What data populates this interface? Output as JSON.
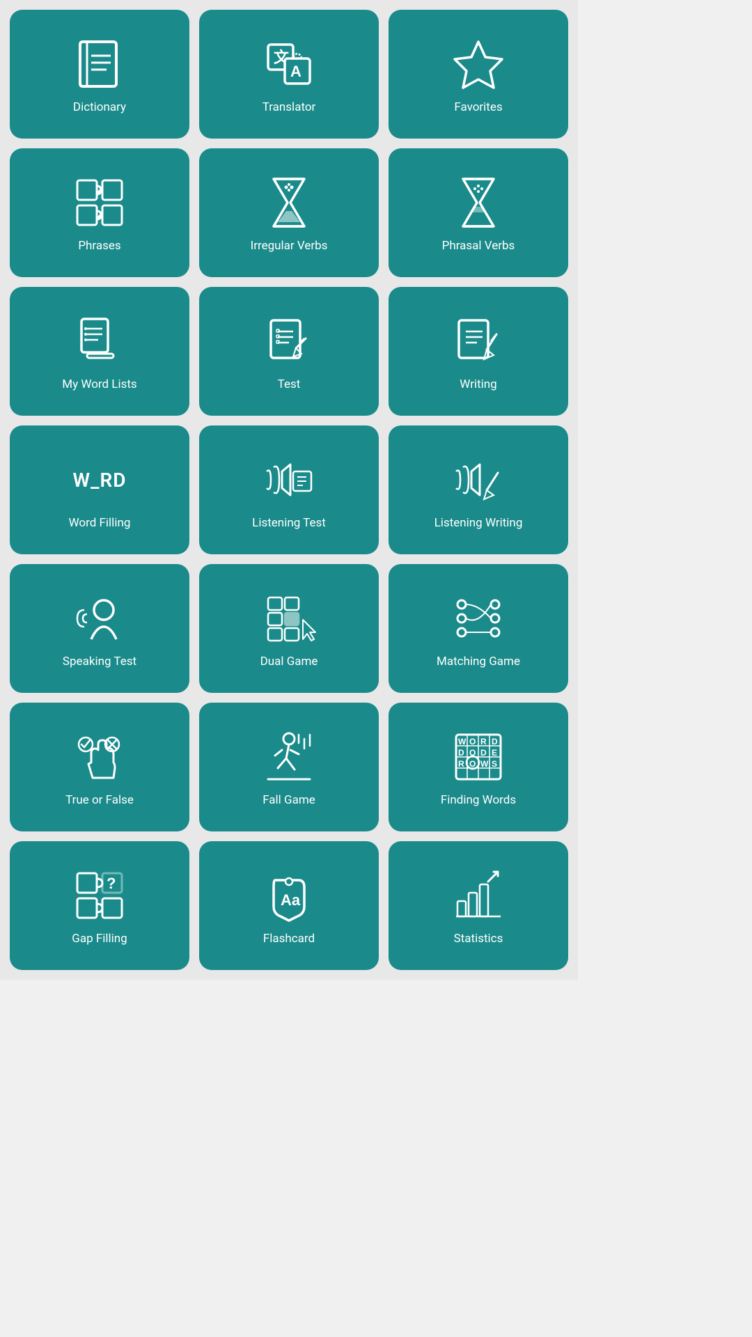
{
  "tiles": [
    {
      "id": "dictionary",
      "label": "Dictionary",
      "icon": "dictionary"
    },
    {
      "id": "translator",
      "label": "Translator",
      "icon": "translator"
    },
    {
      "id": "favorites",
      "label": "Favorites",
      "icon": "favorites"
    },
    {
      "id": "phrases",
      "label": "Phrases",
      "icon": "phrases"
    },
    {
      "id": "irregular-verbs",
      "label": "Irregular Verbs",
      "icon": "hourglass"
    },
    {
      "id": "phrasal-verbs",
      "label": "Phrasal Verbs",
      "icon": "hourglass2"
    },
    {
      "id": "my-word-lists",
      "label": "My Word Lists",
      "icon": "wordlists"
    },
    {
      "id": "test",
      "label": "Test",
      "icon": "test"
    },
    {
      "id": "writing",
      "label": "Writing",
      "icon": "writing"
    },
    {
      "id": "word-filling",
      "label": "Word Filling",
      "icon": "wordfilling"
    },
    {
      "id": "listening-test",
      "label": "Listening Test",
      "icon": "listeningtest"
    },
    {
      "id": "listening-writing",
      "label": "Listening Writing",
      "icon": "listeningwriting"
    },
    {
      "id": "speaking-test",
      "label": "Speaking Test",
      "icon": "speakingtest"
    },
    {
      "id": "dual-game",
      "label": "Dual Game",
      "icon": "dualgame"
    },
    {
      "id": "matching-game",
      "label": "Matching Game",
      "icon": "matchinggame"
    },
    {
      "id": "true-or-false",
      "label": "True or False",
      "icon": "trueorfalse"
    },
    {
      "id": "fall-game",
      "label": "Fall Game",
      "icon": "fallgame"
    },
    {
      "id": "finding-words",
      "label": "Finding Words",
      "icon": "findingwords"
    },
    {
      "id": "gap-filling",
      "label": "Gap Filling",
      "icon": "gapfilling"
    },
    {
      "id": "flashcard",
      "label": "Flashcard",
      "icon": "flashcard"
    },
    {
      "id": "statistics",
      "label": "Statistics",
      "icon": "statistics"
    }
  ]
}
